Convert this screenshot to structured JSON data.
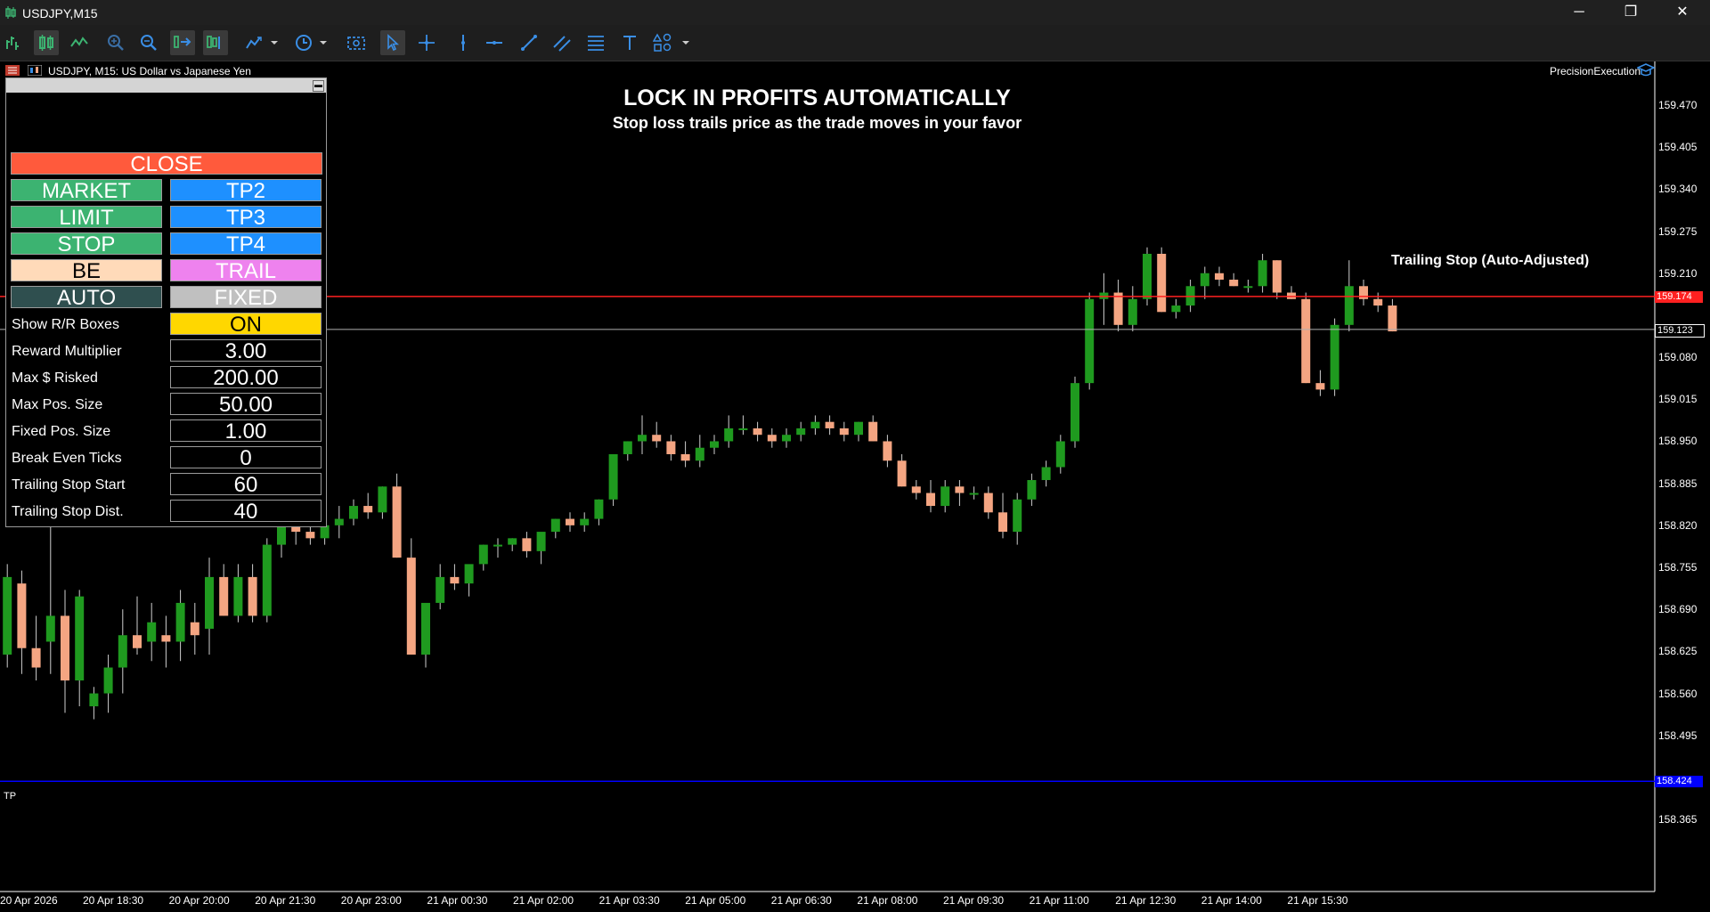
{
  "window": {
    "title": "USDJPY,M15",
    "min_glyph": "─",
    "max_glyph": "❐",
    "close_glyph": "✕"
  },
  "toolbar": {
    "icons": [
      "new-order-icon",
      "candlestick-icon",
      "line-chart-icon",
      "zoom-in-icon",
      "zoom-out-icon",
      "auto-scroll-icon",
      "chart-shift-icon",
      "indicators-icon",
      "period-icon",
      "screenshot-icon",
      "cursor-icon",
      "crosshair-icon",
      "vertical-line-icon",
      "horizontal-line-icon",
      "trend-line-icon",
      "channel-icon",
      "fibonacci-icon",
      "text-icon",
      "shapes-icon"
    ]
  },
  "chart": {
    "symbol_label": "USDJPY, M15:  US Dollar vs Japanese Yen",
    "ea_name": "PrecisionExecution",
    "headline": "LOCK IN PROFITS AUTOMATICALLY",
    "subline": "Stop loss trails price as the trade moves in your favor",
    "trail_note": "Trailing Stop (Auto-Adjusted)",
    "tp_label": "TP",
    "price_ticks": [
      "159.470",
      "159.405",
      "159.340",
      "159.275",
      "159.210",
      "159.080",
      "159.015",
      "158.950",
      "158.885",
      "158.820",
      "158.755",
      "158.690",
      "158.625",
      "158.560",
      "158.495",
      "158.365"
    ],
    "time_ticks": [
      "20 Apr 2026",
      "20 Apr 18:30",
      "20 Apr 20:00",
      "20 Apr 21:30",
      "20 Apr 23:00",
      "21 Apr 00:30",
      "21 Apr 02:00",
      "21 Apr 03:30",
      "21 Apr 05:00",
      "21 Apr 06:30",
      "21 Apr 08:00",
      "21 Apr 09:30",
      "21 Apr 11:00",
      "21 Apr 12:30",
      "21 Apr 14:00",
      "21 Apr 15:30"
    ],
    "stop_tag": "159.174",
    "bid_tag": "159.123",
    "tp_tag": "158.424",
    "colors": {
      "bull": "#1f9a1f",
      "bear": "#f4a582",
      "stop": "#ff2020",
      "tp": "#0000ff",
      "ask": "#b0b0b0"
    }
  },
  "chart_data": {
    "type": "candlestick",
    "ohlc": [
      [
        158.78,
        158.8,
        158.6,
        158.62
      ],
      [
        158.62,
        158.76,
        158.6,
        158.74
      ],
      [
        158.73,
        158.75,
        158.59,
        158.63
      ],
      [
        158.63,
        158.68,
        158.58,
        158.6
      ],
      [
        158.64,
        158.84,
        158.59,
        158.68
      ],
      [
        158.68,
        158.72,
        158.53,
        158.58
      ],
      [
        158.58,
        158.72,
        158.54,
        158.71
      ],
      [
        158.54,
        158.57,
        158.52,
        158.56
      ],
      [
        158.56,
        158.62,
        158.53,
        158.6
      ],
      [
        158.6,
        158.69,
        158.56,
        158.65
      ],
      [
        158.65,
        158.71,
        158.62,
        158.63
      ],
      [
        158.64,
        158.7,
        158.61,
        158.67
      ],
      [
        158.65,
        158.68,
        158.6,
        158.64
      ],
      [
        158.64,
        158.72,
        158.61,
        158.7
      ],
      [
        158.67,
        158.7,
        158.62,
        158.65
      ],
      [
        158.66,
        158.77,
        158.62,
        158.74
      ],
      [
        158.74,
        158.76,
        158.68,
        158.68
      ],
      [
        158.68,
        158.76,
        158.67,
        158.74
      ],
      [
        158.74,
        158.76,
        158.67,
        158.68
      ],
      [
        158.68,
        158.8,
        158.67,
        158.79
      ],
      [
        158.79,
        158.83,
        158.77,
        158.82
      ],
      [
        158.82,
        158.83,
        158.79,
        158.81
      ],
      [
        158.81,
        158.83,
        158.79,
        158.8
      ],
      [
        158.8,
        158.83,
        158.79,
        158.82
      ],
      [
        158.82,
        158.85,
        158.8,
        158.83
      ],
      [
        158.83,
        158.86,
        158.82,
        158.85
      ],
      [
        158.85,
        158.87,
        158.83,
        158.84
      ],
      [
        158.84,
        158.88,
        158.83,
        158.88
      ],
      [
        158.88,
        158.9,
        158.77,
        158.77
      ],
      [
        158.77,
        158.8,
        158.62,
        158.62
      ],
      [
        158.62,
        158.68,
        158.6,
        158.7
      ],
      [
        158.7,
        158.76,
        158.69,
        158.74
      ],
      [
        158.74,
        158.76,
        158.72,
        158.73
      ],
      [
        158.73,
        158.74,
        158.71,
        158.76
      ],
      [
        158.76,
        158.79,
        158.75,
        158.79
      ],
      [
        158.79,
        158.8,
        158.77,
        158.79
      ],
      [
        158.79,
        158.8,
        158.78,
        158.8
      ],
      [
        158.8,
        158.81,
        158.77,
        158.78
      ],
      [
        158.78,
        158.8,
        158.76,
        158.81
      ],
      [
        158.81,
        158.83,
        158.8,
        158.83
      ],
      [
        158.83,
        158.84,
        158.81,
        158.82
      ],
      [
        158.82,
        158.84,
        158.81,
        158.83
      ],
      [
        158.83,
        158.86,
        158.82,
        158.86
      ],
      [
        158.86,
        158.93,
        158.85,
        158.93
      ],
      [
        158.93,
        158.95,
        158.92,
        158.95
      ],
      [
        158.95,
        158.99,
        158.93,
        158.96
      ],
      [
        158.96,
        158.98,
        158.94,
        158.95
      ],
      [
        158.95,
        158.96,
        158.92,
        158.93
      ],
      [
        158.93,
        158.95,
        158.91,
        158.92
      ],
      [
        158.92,
        158.96,
        158.91,
        158.94
      ],
      [
        158.94,
        158.96,
        158.93,
        158.95
      ],
      [
        158.95,
        158.99,
        158.94,
        158.97
      ],
      [
        158.97,
        158.99,
        158.96,
        158.97
      ],
      [
        158.97,
        158.98,
        158.95,
        158.96
      ],
      [
        158.96,
        158.97,
        158.94,
        158.95
      ],
      [
        158.95,
        158.97,
        158.94,
        158.96
      ],
      [
        158.96,
        158.98,
        158.95,
        158.97
      ],
      [
        158.97,
        158.99,
        158.96,
        158.98
      ],
      [
        158.98,
        158.99,
        158.96,
        158.97
      ],
      [
        158.97,
        158.98,
        158.95,
        158.96
      ],
      [
        158.96,
        158.98,
        158.95,
        158.98
      ],
      [
        158.98,
        158.99,
        158.95,
        158.95
      ],
      [
        158.95,
        158.96,
        158.91,
        158.92
      ],
      [
        158.92,
        158.93,
        158.88,
        158.88
      ],
      [
        158.88,
        158.89,
        158.86,
        158.87
      ],
      [
        158.87,
        158.89,
        158.84,
        158.85
      ],
      [
        158.85,
        158.89,
        158.84,
        158.88
      ],
      [
        158.88,
        158.89,
        158.85,
        158.87
      ],
      [
        158.87,
        158.88,
        158.86,
        158.87
      ],
      [
        158.87,
        158.88,
        158.83,
        158.84
      ],
      [
        158.84,
        158.87,
        158.8,
        158.81
      ],
      [
        158.81,
        158.87,
        158.79,
        158.86
      ],
      [
        158.86,
        158.9,
        158.85,
        158.89
      ],
      [
        158.89,
        158.92,
        158.88,
        158.91
      ],
      [
        158.91,
        158.96,
        158.9,
        158.95
      ],
      [
        158.95,
        159.05,
        158.94,
        159.04
      ],
      [
        159.04,
        159.18,
        159.03,
        159.17
      ],
      [
        159.17,
        159.21,
        159.13,
        159.18
      ],
      [
        159.18,
        159.2,
        159.12,
        159.13
      ],
      [
        159.13,
        159.19,
        159.12,
        159.17
      ],
      [
        159.17,
        159.25,
        159.16,
        159.24
      ],
      [
        159.24,
        159.25,
        159.15,
        159.15
      ],
      [
        159.15,
        159.17,
        159.14,
        159.16
      ],
      [
        159.16,
        159.2,
        159.15,
        159.19
      ],
      [
        159.19,
        159.22,
        159.17,
        159.21
      ],
      [
        159.21,
        159.22,
        159.19,
        159.2
      ],
      [
        159.2,
        159.21,
        159.19,
        159.19
      ],
      [
        159.19,
        159.2,
        159.18,
        159.19
      ],
      [
        159.19,
        159.24,
        159.18,
        159.23
      ],
      [
        159.23,
        159.23,
        159.17,
        159.18
      ],
      [
        159.18,
        159.19,
        159.17,
        159.17
      ],
      [
        159.17,
        159.18,
        159.04,
        159.04
      ],
      [
        159.04,
        159.06,
        159.02,
        159.03
      ],
      [
        159.03,
        159.14,
        159.02,
        159.13
      ],
      [
        159.13,
        159.23,
        159.12,
        159.19
      ],
      [
        159.19,
        159.2,
        159.16,
        159.17
      ],
      [
        159.17,
        159.18,
        159.15,
        159.16
      ],
      [
        159.16,
        159.17,
        159.12,
        159.12
      ]
    ],
    "stop_level": 159.174,
    "bid_level": 159.123,
    "tp_level": 158.424,
    "ylim": [
      158.31,
      159.51
    ]
  },
  "panel": {
    "minimize_glyph": "▬",
    "buttons": {
      "close": "CLOSE",
      "market": "MARKET",
      "tp2": "TP2",
      "limit": "LIMIT",
      "tp3": "TP3",
      "stop": "STOP",
      "tp4": "TP4",
      "be": "BE",
      "trail": "TRAIL",
      "auto": "AUTO",
      "fixed": "FIXED",
      "rr_toggle": "ON"
    },
    "colors": {
      "close": "#ff5a3c",
      "green": "#3cb371",
      "blue": "#1e90ff",
      "be": "#ffdab9",
      "trail": "#ee82ee",
      "auto": "#2f4f4f",
      "fixed": "#c0c0c0",
      "on": "#ffd700"
    },
    "fields": [
      {
        "label": "Show R/R Boxes",
        "value": "ON"
      },
      {
        "label": "Reward Multiplier",
        "value": "3.00"
      },
      {
        "label": "Max $ Risked",
        "value": "200.00"
      },
      {
        "label": "Max Pos. Size",
        "value": "50.00"
      },
      {
        "label": "Fixed Pos. Size",
        "value": "1.00"
      },
      {
        "label": "Break Even Ticks",
        "value": "0"
      },
      {
        "label": "Trailing Stop Start",
        "value": "60"
      },
      {
        "label": "Trailing Stop Dist.",
        "value": "40"
      }
    ]
  }
}
